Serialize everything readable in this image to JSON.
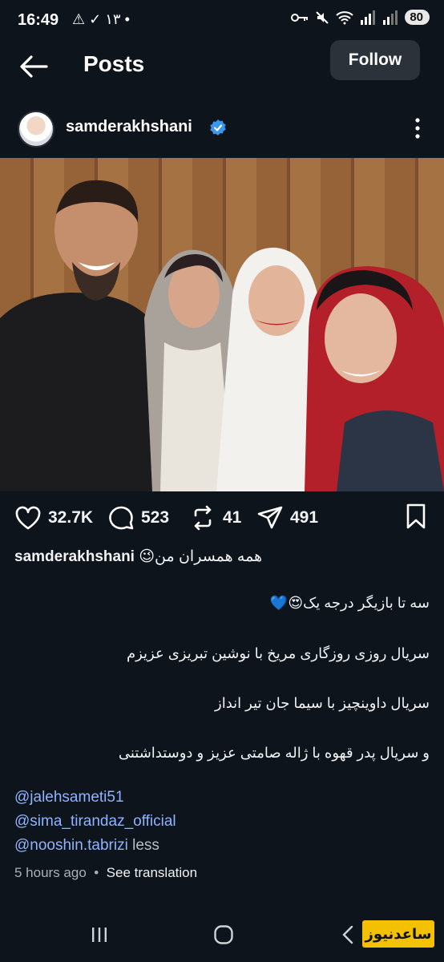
{
  "status_bar": {
    "time": "16:49",
    "left_icons_text": "⚠ ✓ ١٣ •",
    "battery": "80"
  },
  "header": {
    "title": "Posts",
    "follow_label": "Follow"
  },
  "post": {
    "username": "samderakhshani",
    "stats": {
      "likes": "32.7K",
      "comments": "523",
      "reposts": "41",
      "shares": "491"
    },
    "caption_first": "همه همسران من😉",
    "caption_lines": [
      "سه تا بازیگر درجه یک😍💙",
      "سریال روزی روزگاری مریخ با نوشین تبریزی عزیزم",
      "سریال داوینچیز با سیما جان تیر انداز",
      "و سریال پدر قهوه با ژاله صامتی عزیز و دوستداشتنی"
    ],
    "mentions": [
      "@jalehsameti51",
      "@sima_tirandaz_official",
      "@nooshin.tabrizi"
    ],
    "less_label": "less",
    "time_ago": "5 hours ago",
    "dot": "•",
    "see_translation": "See translation"
  },
  "watermark": "ساعدنیوز",
  "colors": {
    "background": "#0e141b",
    "follow_button": "#2b323a",
    "verified": "#3897f0",
    "mention": "#8fb3ff"
  }
}
